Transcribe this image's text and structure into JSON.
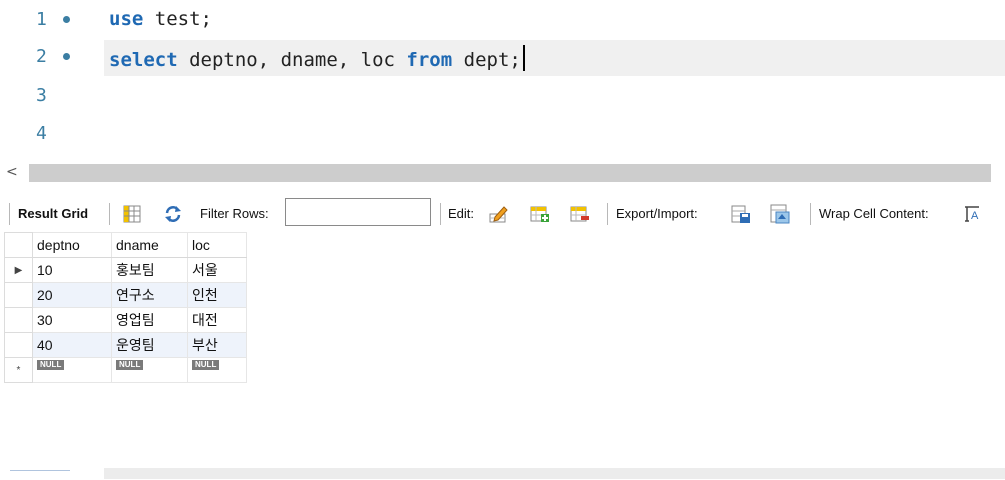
{
  "editor": {
    "lines": [
      {
        "num": "1",
        "has_dot": true,
        "tokens": [
          {
            "t": "use",
            "kw": true
          },
          {
            "t": " test;",
            "kw": false
          }
        ]
      },
      {
        "num": "2",
        "has_dot": true,
        "tokens": [
          {
            "t": "select",
            "kw": true
          },
          {
            "t": " deptno, dname, loc ",
            "kw": false
          },
          {
            "t": "from",
            "kw": true
          },
          {
            "t": " dept;",
            "kw": false
          }
        ]
      },
      {
        "num": "3",
        "has_dot": false,
        "tokens": []
      },
      {
        "num": "4",
        "has_dot": false,
        "tokens": []
      }
    ],
    "current_line": 2
  },
  "scrollbar": {
    "left_arrow": "<"
  },
  "toolbar": {
    "result_grid_label": "Result Grid",
    "filter_rows_label": "Filter Rows:",
    "filter_value": "",
    "edit_label": "Edit:",
    "export_import_label": "Export/Import:",
    "wrap_label": "Wrap Cell Content:",
    "icons": [
      "grid-view-icon",
      "refresh-icon",
      "edit-row-icon",
      "add-row-icon",
      "delete-row-icon",
      "export-icon",
      "import-icon",
      "wrap-cell-icon"
    ]
  },
  "grid": {
    "columns": [
      "deptno",
      "dname",
      "loc"
    ],
    "rows": [
      [
        "10",
        "홍보팀",
        "서울"
      ],
      [
        "20",
        "연구소",
        "인천"
      ],
      [
        "30",
        "영업팀",
        "대전"
      ],
      [
        "40",
        "운영팀",
        "부산"
      ]
    ],
    "null_label": "NULL",
    "current_row_marker": "▶",
    "new_row_marker": "*"
  },
  "colors": {
    "keyword": "#1f69b3",
    "line_number": "#3b7ea3",
    "alt_row": "#eef3fb",
    "current_line_bg": "#f0f0f0"
  }
}
